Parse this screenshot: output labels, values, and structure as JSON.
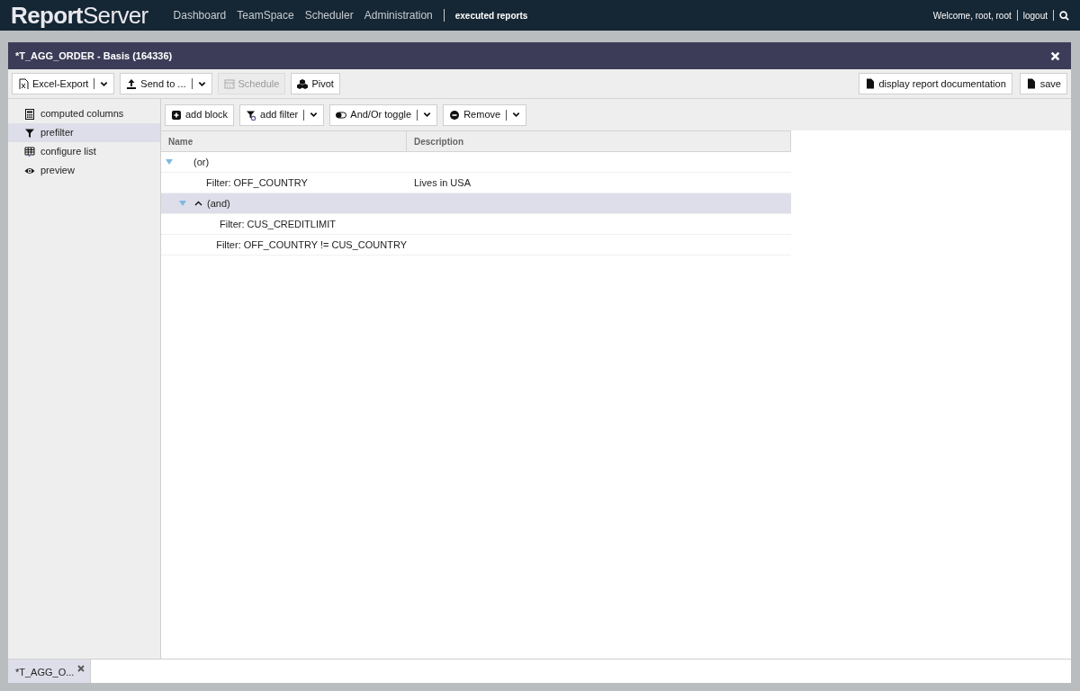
{
  "topbar": {
    "logo_bold": "Report",
    "logo_light": "Server",
    "nav": [
      "Dashboard",
      "TeamSpace",
      "Scheduler",
      "Administration"
    ],
    "executed": "executed reports",
    "welcome": "Welcome, root, root",
    "logout": "logout"
  },
  "window": {
    "title": "*T_AGG_ORDER - Basis (164336)"
  },
  "toolbar": {
    "left": [
      {
        "label": "Excel-Export",
        "dropdown": true,
        "disabled": false
      },
      {
        "label": "Send to ...",
        "dropdown": true,
        "disabled": false
      },
      {
        "label": "Schedule",
        "dropdown": false,
        "disabled": true
      },
      {
        "label": "Pivot",
        "dropdown": false,
        "disabled": false
      }
    ],
    "right": [
      {
        "label": "display report documentation",
        "dropdown": false,
        "disabled": false
      },
      {
        "label": "save",
        "dropdown": false,
        "disabled": false
      }
    ]
  },
  "sidebar": {
    "items": [
      {
        "label": "computed columns",
        "selected": false
      },
      {
        "label": "prefilter",
        "selected": true
      },
      {
        "label": "configure list",
        "selected": false
      },
      {
        "label": "preview",
        "selected": false
      }
    ]
  },
  "filter_toolbar": [
    {
      "label": "add block",
      "dropdown": false
    },
    {
      "label": "add filter",
      "dropdown": true
    },
    {
      "label": "And/Or toggle",
      "dropdown": true
    },
    {
      "label": "Remove",
      "dropdown": true
    }
  ],
  "table": {
    "columns": [
      "Name",
      "Description"
    ],
    "tree": [
      {
        "kind": "or",
        "label": "(or)",
        "expanded": true,
        "selected": false,
        "children": [
          {
            "kind": "filter",
            "label": "Filter: OFF_COUNTRY",
            "description": "Lives in USA",
            "selected": false
          },
          {
            "kind": "and",
            "label": "(and)",
            "expanded": true,
            "selected": true,
            "children": [
              {
                "kind": "filter",
                "label": "Filter: CUS_CREDITLIMIT",
                "selected": false
              },
              {
                "kind": "filter",
                "label": "Filter: OFF_COUNTRY != CUS_COUNTRY",
                "selected": false
              }
            ]
          }
        ]
      }
    ]
  },
  "bottom_tabs": [
    {
      "label": "*T_AGG_O...",
      "selected": true
    }
  ]
}
